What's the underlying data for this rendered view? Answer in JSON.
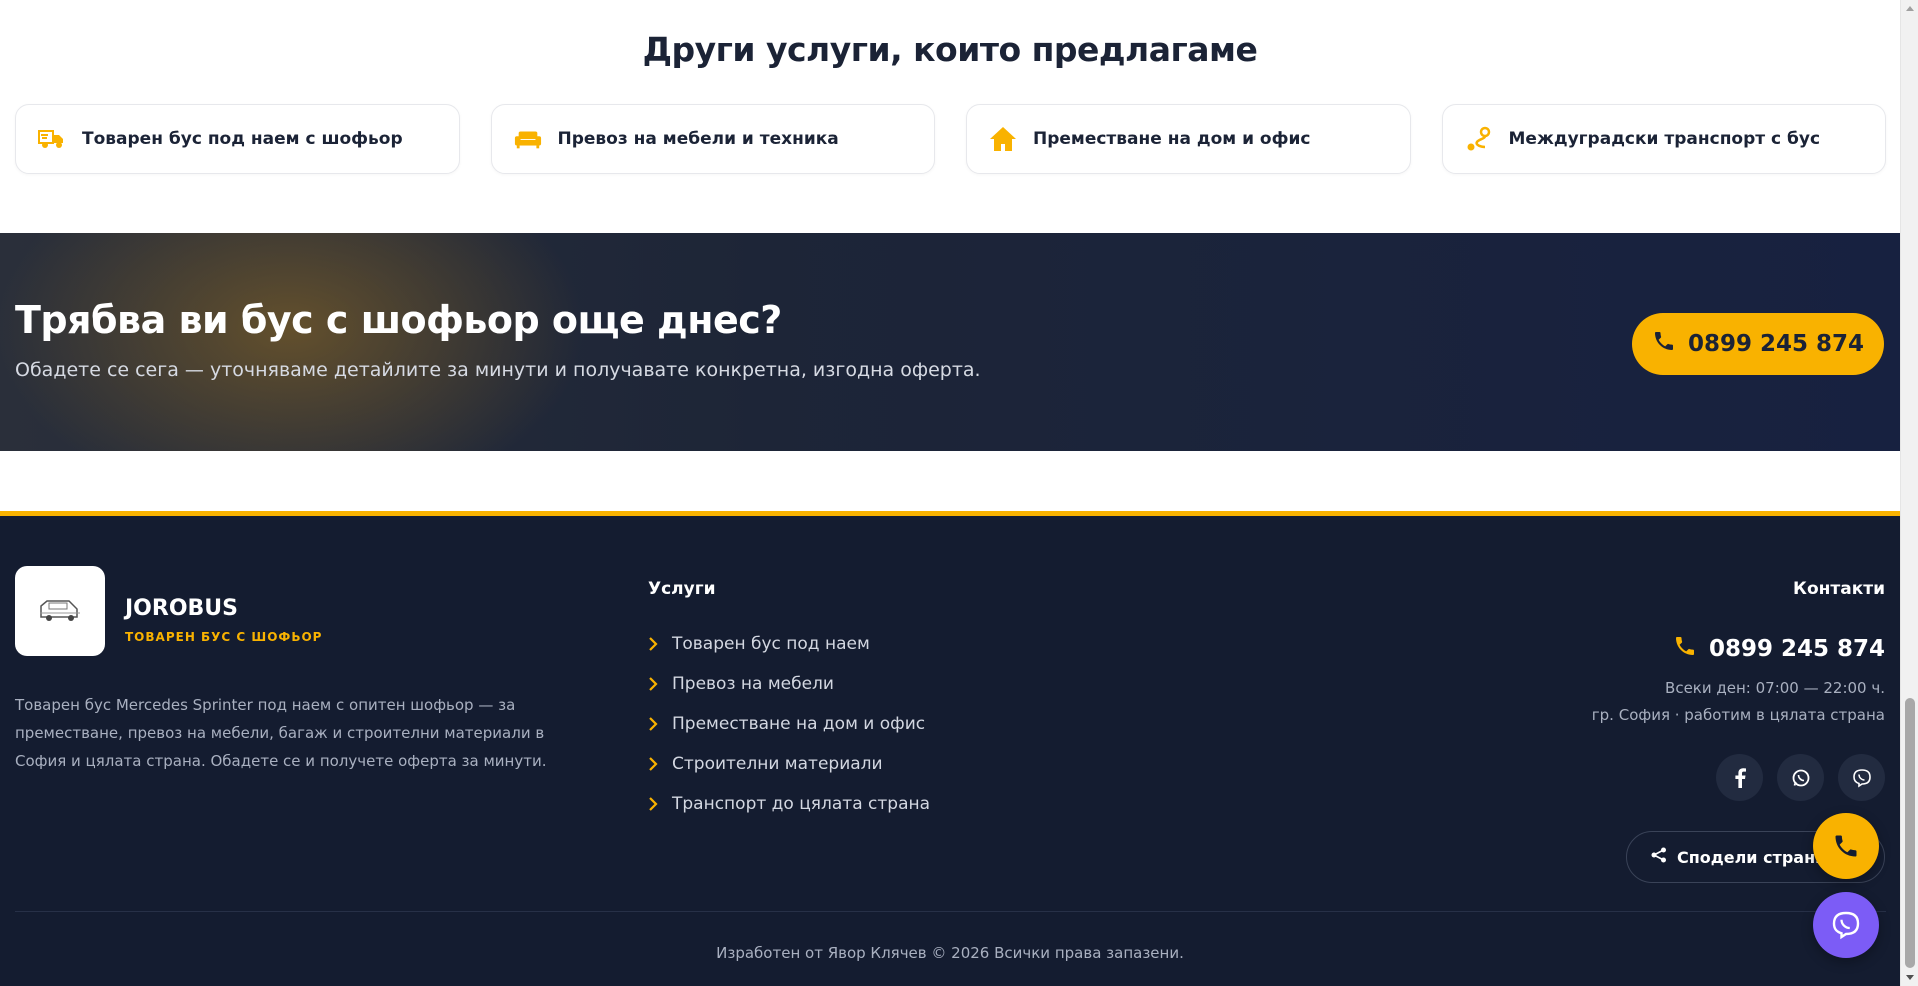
{
  "services": {
    "title": "Други услуги, които предлагаме",
    "items": [
      {
        "label": "Товарен бус под наем с шофьор",
        "icon": "truck-fast-icon"
      },
      {
        "label": "Превоз на мебели и техника",
        "icon": "couch-icon"
      },
      {
        "label": "Преместване на дом и офис",
        "icon": "house-icon"
      },
      {
        "label": "Междуградски транспорт с бус",
        "icon": "route-icon"
      }
    ]
  },
  "cta": {
    "title": "Трябва ви бус с шофьор още днес?",
    "subtitle": "Обадете се сега — уточняваме детайлите за минути и получавате конкретна, изгодна оферта.",
    "phone": "0899 245 874"
  },
  "footer": {
    "brand": "JOROBUS",
    "tagline": "ТОВАРЕН БУС С ШОФЬОР",
    "about": "Товарен бус Mercedes Sprinter под наем с опитен шофьор — за преместване, превоз на мебели, багаж и строителни материали в София и цялата страна. Обадете се и получете оферта за минути.",
    "services_title": "Услуги",
    "links": [
      "Товарен бус под наем",
      "Превоз на мебели",
      "Преместване на дом и офис",
      "Строителни материали",
      "Транспорт до цялата страна"
    ],
    "contacts_title": "Контакти",
    "phone": "0899 245 874",
    "hours": "Всеки ден: 07:00 — 22:00 ч.",
    "area": "гр. София · работим в цялата страна",
    "share_label": "Сподели страни",
    "copyright": "Изработен от Явор Клячев © 2026 Всички права запазени."
  },
  "colors": {
    "accent": "#f9b200",
    "navy": "#141c30",
    "viber": "#7c5cf6"
  }
}
